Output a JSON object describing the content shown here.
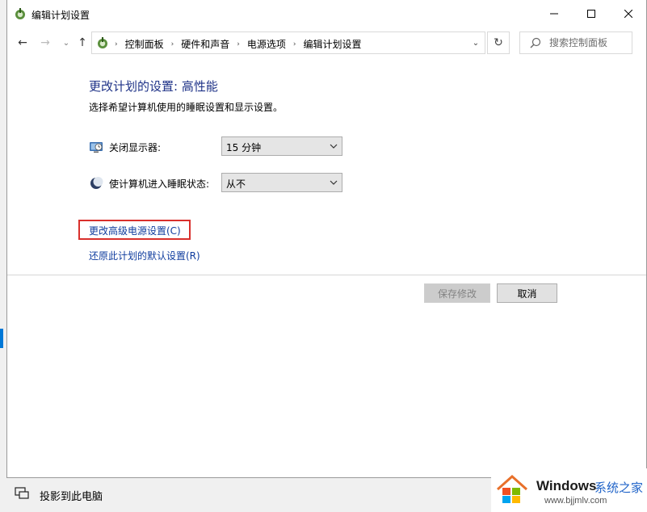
{
  "window": {
    "title": "编辑计划设置",
    "icon": "power-options-icon"
  },
  "controls": {
    "minimize": "minimize-icon",
    "maximize": "maximize-icon",
    "close": "close-icon"
  },
  "address_bar": {
    "breadcrumbs": [
      "控制面板",
      "硬件和声音",
      "电源选项",
      "编辑计划设置"
    ]
  },
  "search": {
    "placeholder": "搜索控制面板"
  },
  "main": {
    "heading": "更改计划的设置: 高性能",
    "subheading": "选择希望计算机使用的睡眠设置和显示设置。",
    "settings": [
      {
        "label": "关闭显示器:",
        "value": "15 分钟",
        "icon": "monitor-icon"
      },
      {
        "label": "使计算机进入睡眠状态:",
        "value": "从不",
        "icon": "moon-icon"
      }
    ],
    "links": {
      "advanced": "更改高级电源设置(C)",
      "restore": "还原此计划的默认设置(R)"
    },
    "buttons": {
      "save": "保存修改",
      "cancel": "取消"
    }
  },
  "taskbar": {
    "project_label": "投影到此电脑"
  },
  "watermark": {
    "brand": "Windows",
    "brand_cn": "系统之家",
    "url": "www.bjjmlv.com"
  },
  "colors": {
    "heading": "#1e3287",
    "link": "#0f3c9e",
    "highlight_border": "#d9302c",
    "accent": "#0078d7"
  }
}
